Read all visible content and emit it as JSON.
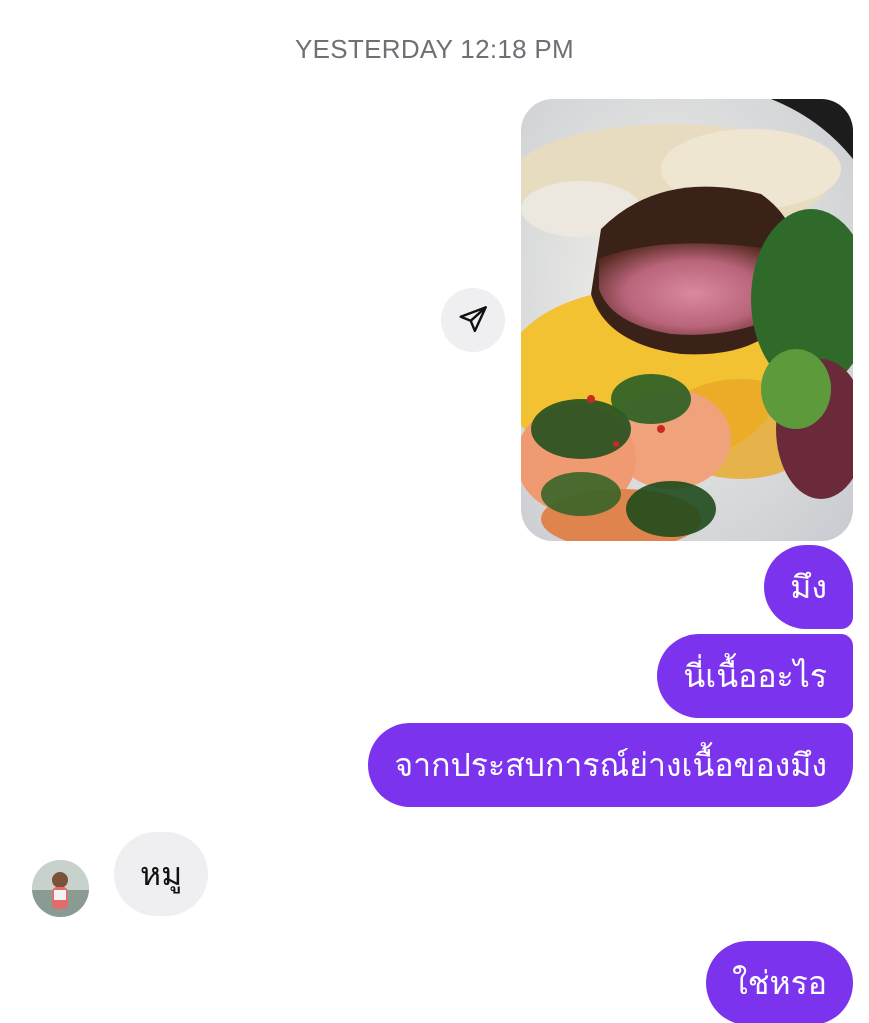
{
  "chat": {
    "timestamp": "YESTERDAY 12:18 PM",
    "sent_photo": {
      "icon": "food-photo",
      "share_icon": "send-paper-plane-icon"
    },
    "outgoing_group_1": [
      "มึง",
      "นี่เนื้ออะไร",
      "จากประสบการณ์ย่างเนื้อของมึง"
    ],
    "incoming": {
      "avatar_icon": "user-avatar",
      "text": "หมู"
    },
    "outgoing_group_2": [
      "ใช่หรอ"
    ]
  },
  "colors": {
    "outgoing_bubble": "#7b33ee",
    "incoming_bubble": "#efeff1",
    "timestamp_text": "#6f6f76"
  }
}
